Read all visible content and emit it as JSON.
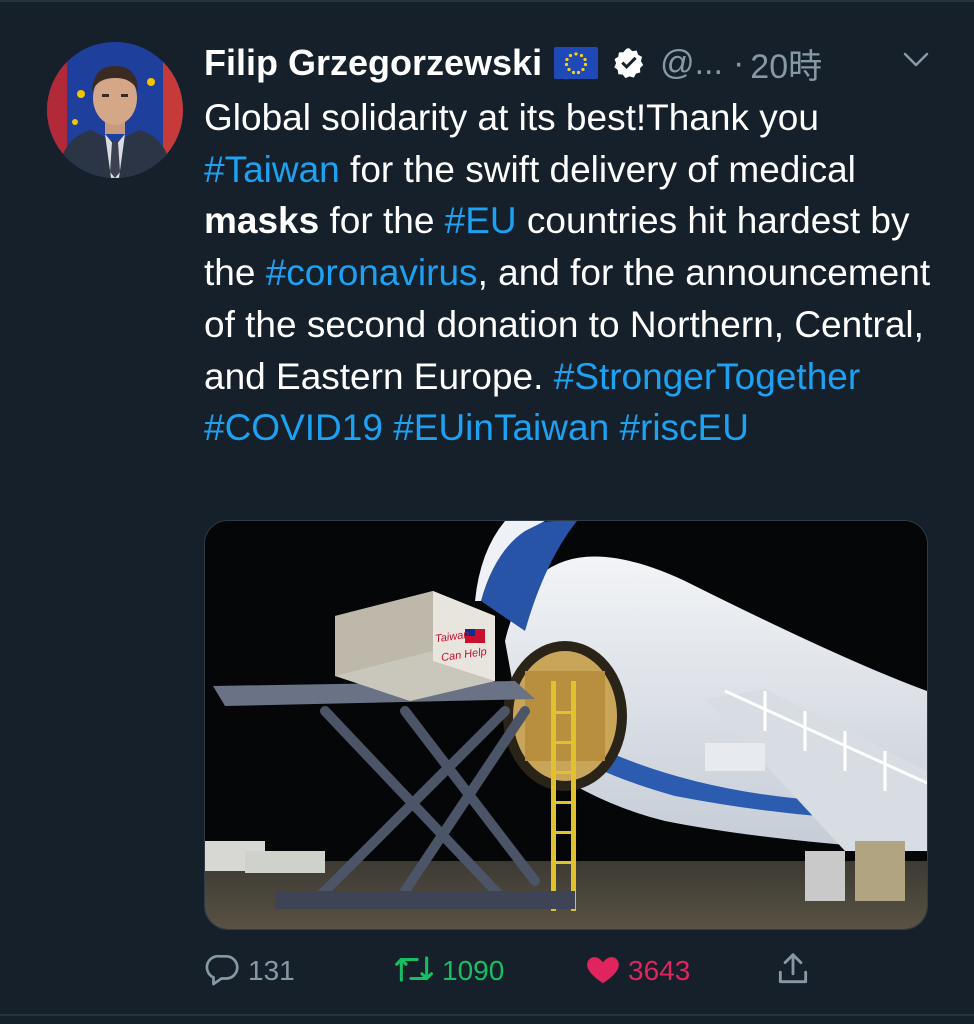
{
  "tweet": {
    "author_name": "Filip Grzegorzewski",
    "handle": "@...",
    "separator": "·",
    "time": "20時",
    "text": {
      "p1": "Global solidarity at its best!Thank you ",
      "tag_taiwan": "#Taiwan",
      "p2": " for the swift delivery of medical ",
      "bold_masks": "masks",
      "p3": " for the ",
      "tag_eu": "#EU",
      "p4": " countries hit hardest by the ",
      "tag_corona": "#coronavirus",
      "p5": ", and for the announcement of the second donation to Northern, Central, and Eastern Europe. ",
      "tag_stronger": "#StrongerTogether",
      "tag_covid": "#COVID19",
      "tag_euintaiwan": "#EUinTaiwan",
      "tag_risceu": "#riscEU"
    },
    "media": {
      "crate_text_line1": "Taiwan",
      "crate_text_line2": "Can Help"
    },
    "actions": {
      "reply_count": "131",
      "retweet_count": "1090",
      "like_count": "3643"
    }
  },
  "colors": {
    "background": "#15202b",
    "link": "#1da1f2",
    "muted": "#8899a6",
    "retweet": "#17bf63",
    "like": "#e0245e"
  },
  "icons": [
    "eu-flag-icon",
    "verified-badge-icon",
    "chevron-down-icon",
    "reply-icon",
    "retweet-icon",
    "heart-icon",
    "share-icon"
  ]
}
